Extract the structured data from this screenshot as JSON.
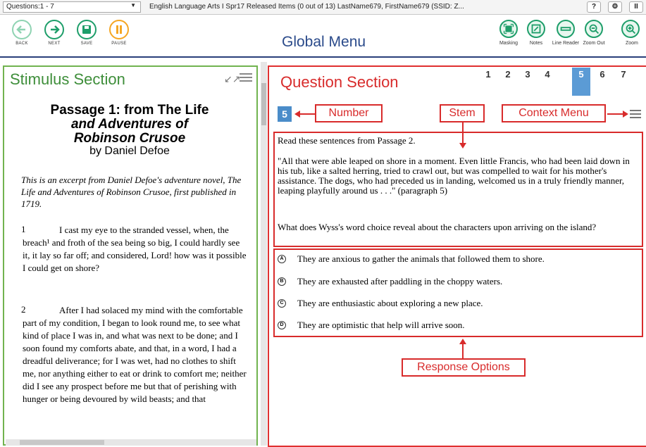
{
  "topbar": {
    "question_select": "Questions:1 - 7",
    "test_info": "English Language Arts I Spr17 Released Items (0 out of 13)   LastName679, FirstName679 (SSID: Z...",
    "help_label": "?",
    "settings_label": "⚙",
    "pause_label": "II"
  },
  "navbar": {
    "title": "Global Menu",
    "buttons": [
      {
        "label": "BACK",
        "color": "#8fd3b2"
      },
      {
        "label": "NEXT",
        "color": "#1e9e6a"
      },
      {
        "label": "SAVE",
        "color": "#1e9e6a"
      },
      {
        "label": "PAUSE",
        "color": "#f5a623"
      }
    ],
    "tools": [
      {
        "label": "Masking",
        "icon": "masking-icon"
      },
      {
        "label": "Notes",
        "icon": "notes-icon"
      },
      {
        "label": "Line Reader",
        "icon": "line-reader-icon"
      },
      {
        "label": "Zoom Out",
        "icon": "zoom-out-icon"
      },
      {
        "label": "Zoom",
        "icon": "zoom-in-icon"
      }
    ]
  },
  "stimulus": {
    "title": "Stimulus Section",
    "passage_line1": "Passage 1: from The Life",
    "passage_line2": "and Adventures of",
    "passage_line3": "Robinson Crusoe",
    "author": "by Daniel Defoe",
    "intro": "This is an excerpt from Daniel Defoe's adventure novel, The Life and Adventures of Robinson Crusoe, first published in 1719.",
    "paragraphs": [
      {
        "num": "1",
        "text": "I cast my eye to the stranded vessel, when, the breach¹ and froth of the sea being so big, I could hardly see it, it lay so far off; and considered, Lord! how was it possible I could get on shore?"
      },
      {
        "num": "2",
        "text": "After I had solaced my mind with the comfortable part of my condition, I began to look round me, to see what kind of place I was in, and what was next to be done; and I soon found my comforts abate, and that, in a word, I had a dreadful deliverance; for I was wet, had no clothes to shift me, nor anything either to eat or drink to comfort me; neither did I see any prospect before me but that of perishing with hunger or being devoured by wild beasts; and that"
      }
    ]
  },
  "question": {
    "title": "Question Section",
    "tabs": [
      "1",
      "2",
      "3",
      "4",
      "5",
      "6",
      "7"
    ],
    "active_tab": "5",
    "number": "5",
    "callouts": {
      "number": "Number",
      "stem": "Stem",
      "context_menu": "Context Menu",
      "response_options": "Response Options"
    },
    "stem_intro": "Read these sentences from Passage 2.",
    "stem_quote": "\"All that were able leaped on shore in a moment. Even little Francis, who had been laid down in his tub, like a salted herring, tried to crawl out, but was compelled to wait for his mother's assistance. The dogs, who had preceded us in landing, welcomed us in a truly friendly manner, leaping playfully around us . . .\" (paragraph 5)",
    "stem_question": "What does Wyss's word choice reveal about the characters upon arriving on the island?",
    "options": [
      {
        "letter": "A",
        "text": "They are anxious to gather the animals that followed them to shore."
      },
      {
        "letter": "B",
        "text": "They are exhausted after paddling in the choppy waters."
      },
      {
        "letter": "C",
        "text": "They are enthusiastic about exploring a new place."
      },
      {
        "letter": "D",
        "text": "They are optimistic that help will arrive soon."
      }
    ]
  }
}
